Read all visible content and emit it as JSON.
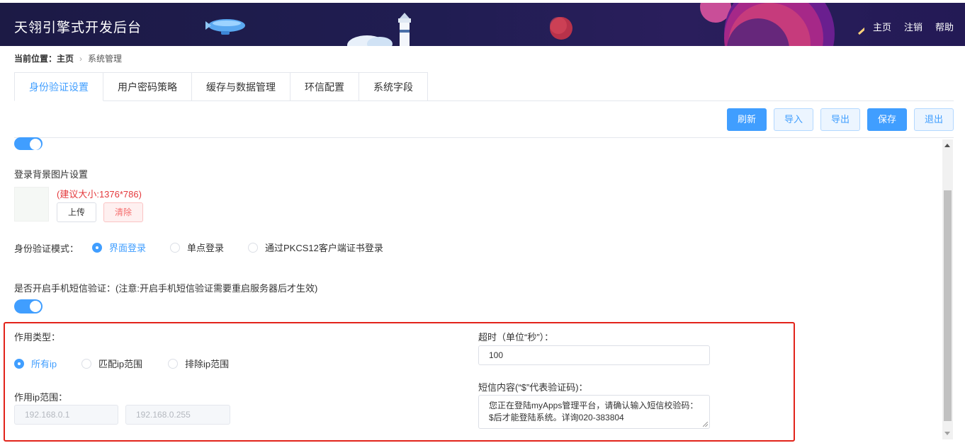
{
  "header": {
    "title": "天翎引擎式开发后台",
    "nav": [
      "主页",
      "注销",
      "帮助"
    ]
  },
  "breadcrumb": {
    "prefix": "当前位置：",
    "home": "主页",
    "current": "系统管理"
  },
  "tabs": [
    {
      "label": "身份验证设置",
      "active": true
    },
    {
      "label": "用户密码策略"
    },
    {
      "label": "缓存与数据管理"
    },
    {
      "label": "环信配置"
    },
    {
      "label": "系统字段"
    }
  ],
  "toolbar": {
    "refresh": "刷新",
    "import": "导入",
    "export": "导出",
    "save": "保存",
    "exit": "退出"
  },
  "login_bg": {
    "label": "登录背景图片设置",
    "hint": "(建议大小:1376*786)",
    "upload": "上传",
    "clear": "清除"
  },
  "auth_mode": {
    "label": "身份验证模式：",
    "options": [
      "界面登录",
      "单点登录",
      "通过PKCS12客户端证书登录"
    ],
    "selected": "界面登录"
  },
  "sms": {
    "label": "是否开启手机短信验证：(注意:开启手机短信验证需要重启服务器后才生效)",
    "enabled": true
  },
  "scope": {
    "type_label": "作用类型：",
    "options": [
      "所有ip",
      "匹配ip范围",
      "排除ip范围"
    ],
    "selected": "所有ip",
    "ip_range_label": "作用ip范围：",
    "ip_start_placeholder": "192.168.0.1",
    "ip_end_placeholder": "192.168.0.255"
  },
  "timeout": {
    "label": "超时（单位“秒”）：",
    "value": "100"
  },
  "sms_content": {
    "label": "短信内容(“$”代表验证码)：",
    "value": "您正在登陆myApps管理平台，请确认输入短信校验码：$后才能登陆系统。详询020-383804"
  },
  "colors": {
    "primary": "#409eff",
    "header_bg": "#1e1c4a",
    "highlight": "#e2231a",
    "danger": "#f56c6c"
  }
}
